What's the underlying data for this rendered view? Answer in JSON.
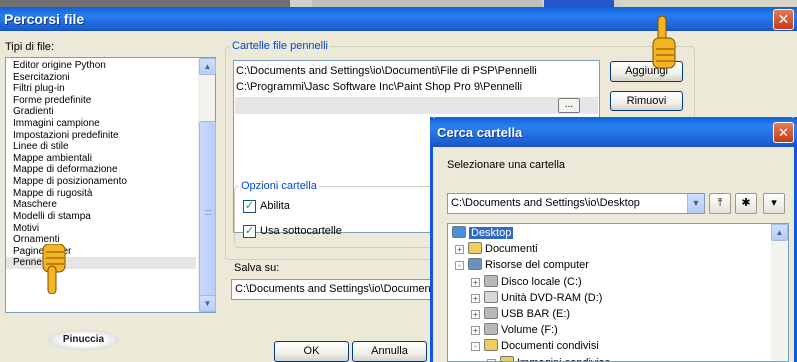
{
  "window": {
    "title": "Percorsi file"
  },
  "file_types": {
    "label": "Tipi di file:",
    "items": [
      "Editor origine Python",
      "Esercitazioni",
      "Filtri plug-in",
      "Forme predefinite",
      "Gradienti",
      "Immagini campione",
      "Impostazioni predefinite",
      "Linee di stile",
      "Mappe ambientali",
      "Mappe di deformazione",
      "Mappe di posizionamento",
      "Mappe di rugosità",
      "Maschere",
      "Modelli di stampa",
      "Motivi",
      "Ornamenti",
      "Pagine mixer",
      "Pennelli"
    ],
    "selected": "Pennelli"
  },
  "brush_folders": {
    "legend": "Cartelle file pennelli",
    "paths": [
      "C:\\Documents and Settings\\io\\Documenti\\File di PSP\\Pennelli",
      "C:\\Programmi\\Jasc Software Inc\\Paint Shop Pro 9\\Pennelli"
    ],
    "browse_label": "...",
    "add_label": "Aggiungi",
    "remove_label": "Rimuovi"
  },
  "folder_options": {
    "legend": "Opzioni cartella",
    "enable_label": "Abilita",
    "enable_checked": true,
    "subfolders_label": "Usa sottocartelle",
    "subfolders_checked": true
  },
  "save_to": {
    "label": "Salva su:",
    "value": "C:\\Documents and Settings\\io\\Document"
  },
  "buttons": {
    "ok": "OK",
    "cancel": "Annulla"
  },
  "logo_text": "Pinuccia",
  "folder_dialog": {
    "title": "Cerca cartella",
    "prompt": "Selezionare una cartella",
    "combo_value": "C:\\Documents and Settings\\io\\Desktop",
    "tree": [
      {
        "label": "Desktop",
        "level": 0,
        "icon": "desktop-icon",
        "selected": true
      },
      {
        "label": "Documenti",
        "level": 1,
        "icon": "folder-icon",
        "expander": "+"
      },
      {
        "label": "Risorse del computer",
        "level": 1,
        "icon": "computer-icon",
        "expander": "-"
      },
      {
        "label": "Disco locale (C:)",
        "level": 2,
        "icon": "drive-icon",
        "expander": "+"
      },
      {
        "label": "Unità DVD-RAM (D:)",
        "level": 2,
        "icon": "cd-drive-icon",
        "expander": "+"
      },
      {
        "label": "USB BAR (E:)",
        "level": 2,
        "icon": "drive-icon",
        "expander": "+"
      },
      {
        "label": "Volume (F:)",
        "level": 2,
        "icon": "drive-icon",
        "expander": "+"
      },
      {
        "label": "Documenti condivisi",
        "level": 2,
        "icon": "folder-icon",
        "expander": "-"
      },
      {
        "label": "Immagini condivise",
        "level": 3,
        "icon": "folder-icon",
        "expander": "+"
      }
    ]
  },
  "colors": {
    "titlebar": "#0a64d8",
    "accent": "#0046d5",
    "face": "#ece9d8",
    "close": "#c43c18"
  }
}
